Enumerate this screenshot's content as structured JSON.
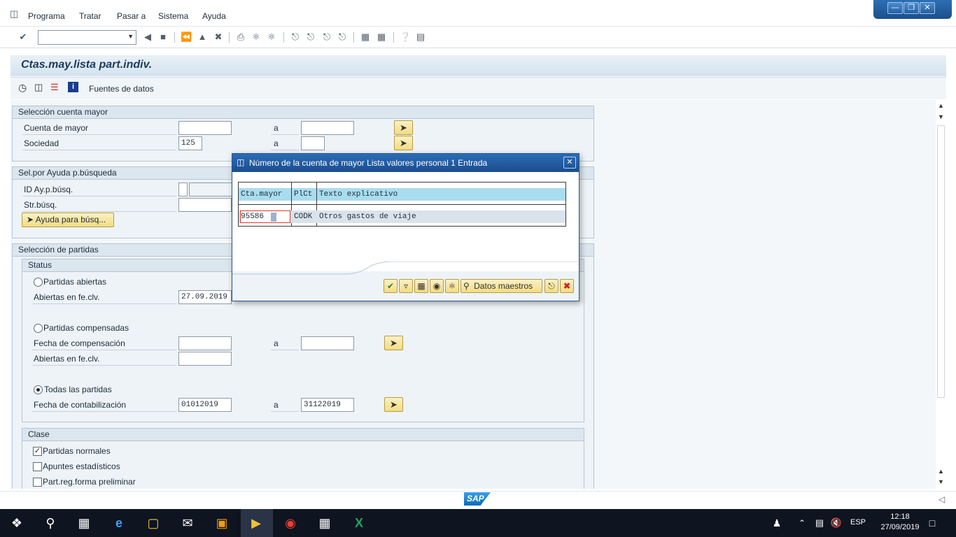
{
  "menu": {
    "items": [
      "Programa",
      "Tratar",
      "Pasar a",
      "Sistema",
      "Ayuda"
    ]
  },
  "toolbar": {
    "command_value": ""
  },
  "window": {
    "title": "Ctas.may.lista part.indiv.",
    "app_toolbar_label": "Fuentes de datos"
  },
  "groups": {
    "seleccion_cuenta": {
      "header": "Selección cuenta mayor",
      "cuenta_label": "Cuenta de mayor",
      "cuenta_from": "",
      "cuenta_to_label": "a",
      "cuenta_to": "",
      "sociedad_label": "Sociedad",
      "sociedad_value": "125",
      "sociedad_to_label": "a",
      "sociedad_to": ""
    },
    "ayuda_busqueda": {
      "header": "Sel.por Ayuda p.búsqueda",
      "id_label": "ID Ay.p.búsq.",
      "str_label": "Str.búsq.",
      "button_label": "Ayuda para búsq..."
    },
    "seleccion_partidas": {
      "header": "Selección de partidas",
      "status_header": "Status",
      "abiertas_label": "Partidas abiertas",
      "abiertas_fecha_label": "Abiertas en fe.clv.",
      "abiertas_fecha_value": "27.09.2019",
      "compensadas_label": "Partidas compensadas",
      "fecha_comp_label": "Fecha de compensación",
      "fecha_comp_to_label": "a",
      "abiertas_fecha2_label": "Abiertas en fe.clv.",
      "todas_label": "Todas las partidas",
      "fecha_contab_label": "Fecha de contabilización",
      "fecha_contab_from": "01012019",
      "fecha_contab_to_label": "a",
      "fecha_contab_to": "31122019",
      "selected_radio": "todas"
    },
    "clase": {
      "header": "Clase",
      "normales_label": "Partidas normales",
      "normales_checked": true,
      "estadisticos_label": "Apuntes estadísticos",
      "estadisticos_checked": false,
      "preliminar_label": "Part.reg.forma preliminar",
      "preliminar_checked": false
    }
  },
  "dialog": {
    "title": "Número de la cuenta de mayor Lista valores personal 1 Entrada",
    "columns": [
      "Cta.mayor",
      "PlCt",
      "Texto explicativo"
    ],
    "rows": [
      [
        "95586",
        "CODK",
        "Otros gastos de viaje"
      ]
    ],
    "datos_maestros_label": "Datos maestros"
  },
  "status": {
    "logo": "SAP"
  },
  "taskbar": {
    "lang": "ESP",
    "time": "12:18",
    "date": "27/09/2019"
  },
  "colors": {
    "accent": "#1a4e8e",
    "yellow_button": "#f2dc82",
    "grid_header": "#a9dcef"
  }
}
